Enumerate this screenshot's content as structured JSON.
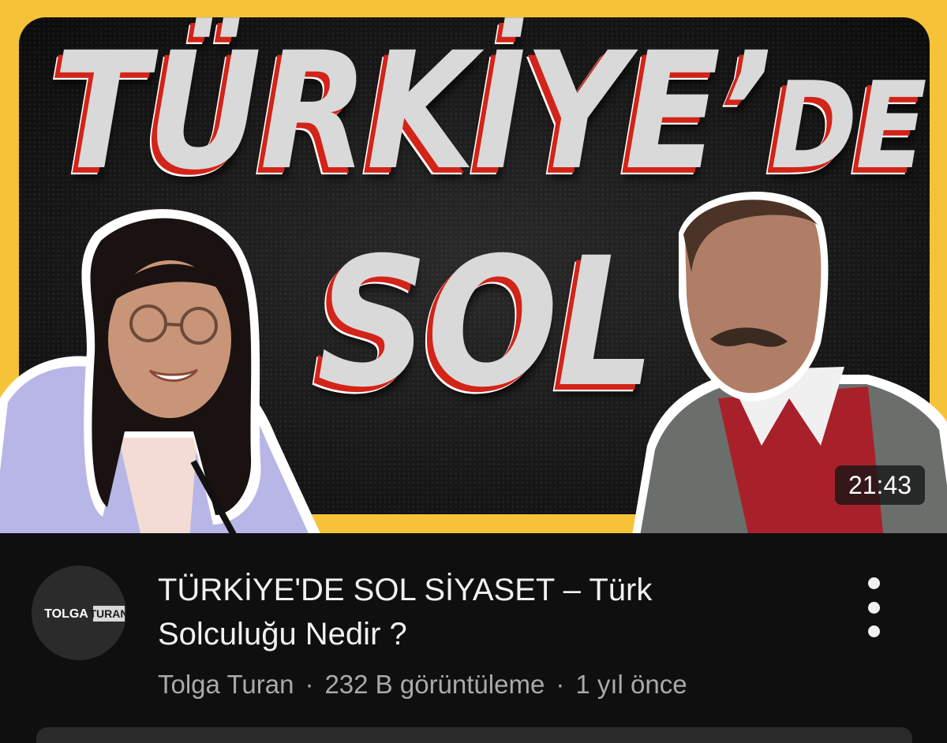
{
  "video": {
    "thumbnail": {
      "headline_line1": "TÜRKİYE’",
      "headline_line1_suffix": "DE",
      "headline_line2": "SOL",
      "frame_color": "#f6c338",
      "accent_color": "#d22418",
      "left_person": "woman-with-glasses",
      "right_person": "man-with-mustache"
    },
    "duration": "21:43",
    "title": "TÜRKİYE'DE SOL SİYASET – Türk Solculuğu Nedir ?",
    "channel_name": "Tolga Turan",
    "views": "232 B görüntüleme",
    "published": "1 yıl önce",
    "separator": "·",
    "avatar_logo": {
      "part1": "TOLGA",
      "part2": "TURAN"
    },
    "more_icon": "vertical-dots-icon"
  }
}
